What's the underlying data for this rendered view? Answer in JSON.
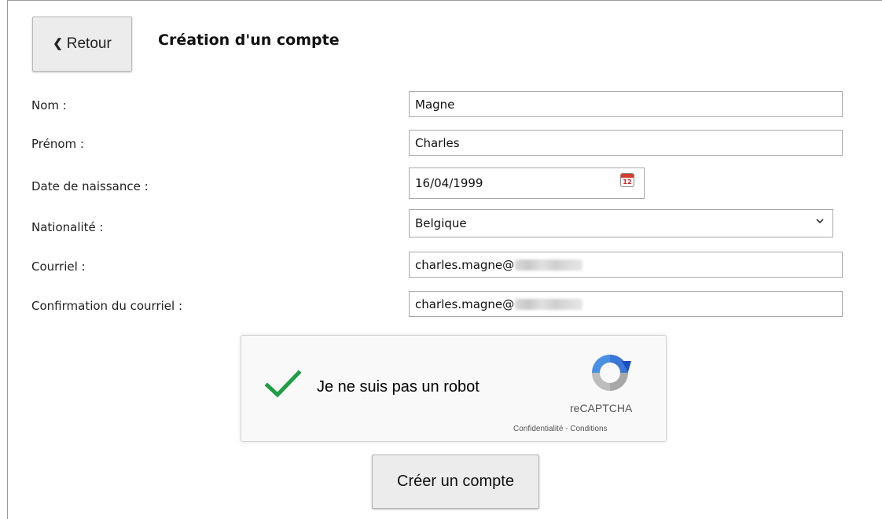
{
  "header": {
    "back_label": "Retour",
    "back_chevron": "❮",
    "title": "Création d'un compte"
  },
  "form": {
    "nom": {
      "label": "Nom :",
      "value": "Magne"
    },
    "prenom": {
      "label": "Prénom :",
      "value": "Charles"
    },
    "date_naissance": {
      "label": "Date de naissance :",
      "value": "16/04/1999",
      "calendar_number": "12"
    },
    "nationalite": {
      "label": "Nationalité :",
      "selected": "Belgique"
    },
    "courriel": {
      "label": "Courriel :",
      "value_prefix": "charles.magne@"
    },
    "confirmation": {
      "label": "Confirmation du courriel :",
      "value_prefix": "charles.magne@"
    }
  },
  "captcha": {
    "text": "Je ne suis pas un robot",
    "brand": "reCAPTCHA",
    "links": "Confidentialité - Conditions",
    "checked": true,
    "colors": {
      "check": "#1e9e45",
      "logo_blue": "#3a77d6",
      "logo_grey": "#a8a8a8"
    }
  },
  "submit": {
    "label": "Créer un compte"
  }
}
